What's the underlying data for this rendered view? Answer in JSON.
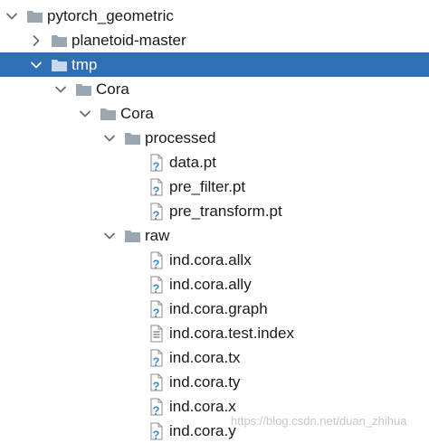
{
  "tree": [
    {
      "label": "pytorch_geometric",
      "depth": 0,
      "type": "folder",
      "expanded": true,
      "selected": false
    },
    {
      "label": "planetoid-master",
      "depth": 1,
      "type": "folder",
      "expanded": false,
      "selected": false
    },
    {
      "label": "tmp",
      "depth": 1,
      "type": "folder",
      "expanded": true,
      "selected": true
    },
    {
      "label": "Cora",
      "depth": 2,
      "type": "folder",
      "expanded": true,
      "selected": false
    },
    {
      "label": "Cora",
      "depth": 3,
      "type": "folder",
      "expanded": true,
      "selected": false
    },
    {
      "label": "processed",
      "depth": 4,
      "type": "folder",
      "expanded": true,
      "selected": false
    },
    {
      "label": "data.pt",
      "depth": 5,
      "type": "unknown-file",
      "selected": false
    },
    {
      "label": "pre_filter.pt",
      "depth": 5,
      "type": "unknown-file",
      "selected": false
    },
    {
      "label": "pre_transform.pt",
      "depth": 5,
      "type": "unknown-file",
      "selected": false
    },
    {
      "label": "raw",
      "depth": 4,
      "type": "folder",
      "expanded": true,
      "selected": false
    },
    {
      "label": "ind.cora.allx",
      "depth": 5,
      "type": "unknown-file",
      "selected": false
    },
    {
      "label": "ind.cora.ally",
      "depth": 5,
      "type": "unknown-file",
      "selected": false
    },
    {
      "label": "ind.cora.graph",
      "depth": 5,
      "type": "unknown-file",
      "selected": false
    },
    {
      "label": "ind.cora.test.index",
      "depth": 5,
      "type": "text-file",
      "selected": false
    },
    {
      "label": "ind.cora.tx",
      "depth": 5,
      "type": "unknown-file",
      "selected": false
    },
    {
      "label": "ind.cora.ty",
      "depth": 5,
      "type": "unknown-file",
      "selected": false
    },
    {
      "label": "ind.cora.x",
      "depth": 5,
      "type": "unknown-file",
      "selected": false
    },
    {
      "label": "ind.cora.y",
      "depth": 5,
      "type": "unknown-file",
      "selected": false
    }
  ],
  "watermark": "https://blog.csdn.net/duan_zhihua",
  "colors": {
    "selection": "#2f6fb6",
    "folder_icon": "#9aa7b0",
    "chevron": "#6e6e6e",
    "question_mark": "#3592c4",
    "file_fill": "#ffffff",
    "file_stroke": "#8c8c8c"
  }
}
